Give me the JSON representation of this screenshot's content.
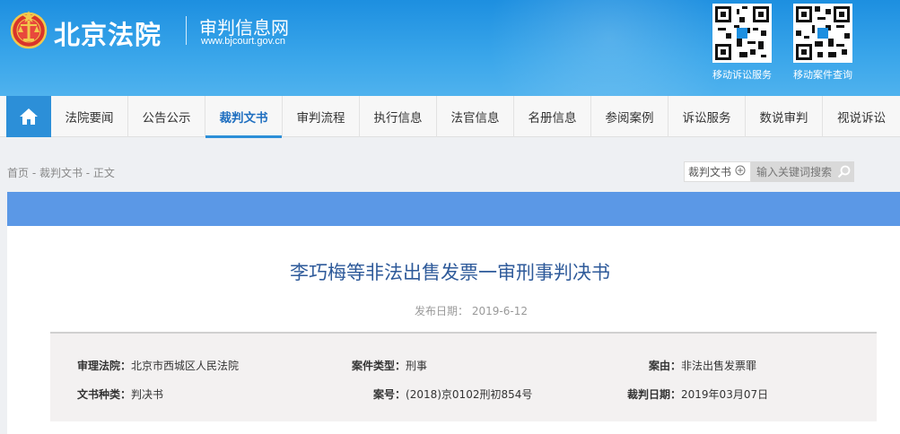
{
  "header": {
    "court_name": "北京法院",
    "site_title": "审判信息网",
    "site_url": "www.bjcourt.gov.cn",
    "qr_codes": [
      {
        "label": "移动诉讼服务"
      },
      {
        "label": "移动案件查询"
      }
    ]
  },
  "nav": {
    "home_icon": "home-icon",
    "items": [
      {
        "label": "法院要闻"
      },
      {
        "label": "公告公示"
      },
      {
        "label": "裁判文书",
        "active": true
      },
      {
        "label": "审判流程"
      },
      {
        "label": "执行信息"
      },
      {
        "label": "法官信息"
      },
      {
        "label": "名册信息"
      },
      {
        "label": "参阅案例"
      },
      {
        "label": "诉讼服务"
      },
      {
        "label": "数说审判"
      },
      {
        "label": "视说诉讼"
      }
    ]
  },
  "breadcrumb": "首页 - 裁判文书 - 正文",
  "search": {
    "category": "裁判文书",
    "placeholder": "输入关键词搜索"
  },
  "document": {
    "title": "李巧梅等非法出售发票一审刑事判决书",
    "publish_label": "发布日期：",
    "publish_date": "2019-6-12",
    "fields": {
      "court_label": "审理法院：",
      "court_value": "北京市西城区人民法院",
      "case_type_label": "案件类型：",
      "case_type_value": "刑事",
      "cause_label": "案由：",
      "cause_value": "非法出售发票罪",
      "doc_type_label": "文书种类：",
      "doc_type_value": "判决书",
      "case_no_label": "案号：",
      "case_no_value": "(2018)京0102刑初854号",
      "judgment_date_label": "裁判日期：",
      "judgment_date_value": "2019年03月07日"
    }
  },
  "colors": {
    "header_blue": "#2c8fd8",
    "band_blue": "#5b98e6",
    "title_blue": "#2e5a9a"
  }
}
